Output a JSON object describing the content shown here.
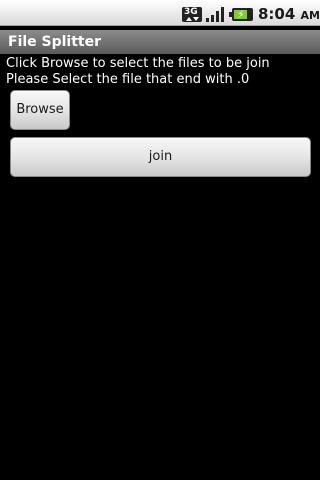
{
  "status_bar": {
    "network_type": "3G",
    "time": "8:04",
    "time_suffix": "AM",
    "icons": [
      "3g-data-icon",
      "signal-strength-icon",
      "battery-charging-icon"
    ],
    "battery_color": "#7dcf2c"
  },
  "app": {
    "title": "File Splitter"
  },
  "content": {
    "instruction_1": "Click Browse to select the files to be join",
    "instruction_2": "Please Select the file that end with .0",
    "browse_label": "Browse",
    "join_label": "join"
  }
}
